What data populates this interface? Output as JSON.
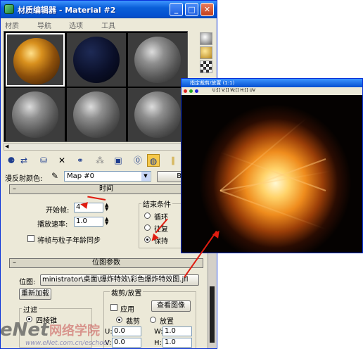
{
  "window": {
    "title": "材质编辑器 - Material #2"
  },
  "menu": [
    "材质",
    "导航",
    "选项",
    "工具"
  ],
  "map_row": {
    "label": "漫反射颜色:",
    "map_name": "Map #0",
    "type": "Bit"
  },
  "time": {
    "header": "时间",
    "start_frame_label": "开始帧:",
    "start_frame": "4",
    "speed_label": "播放速率:",
    "speed": "1.0",
    "sync_label": "将帧与粒子年龄同步"
  },
  "end_condition": {
    "header": "结束条件",
    "options": [
      "循环",
      "往复",
      "保持"
    ],
    "selected": "保持"
  },
  "bitmap": {
    "header": "位图参数",
    "label": "位图:",
    "path": "ministrator\\桌面\\爆炸特效\\彩色爆炸特效图.jfl",
    "reload": "重新加载"
  },
  "crop": {
    "header": "裁剪/放置",
    "apply": "应用",
    "view": "查看图像",
    "crop_label": "裁剪",
    "place_label": "放置",
    "u_label": "U:",
    "u": "0.0",
    "v_label": "V:",
    "v": "0.0",
    "w_label": "W:",
    "w": "1.0",
    "h_label": "H:",
    "h": "1.0"
  },
  "filter": {
    "header": "过滤",
    "option": "四棱锥"
  },
  "preview": {
    "title": "指定裁剪/放置 (1:1)",
    "toolbar": "U:[] V:[] W:[] H:[] UV"
  },
  "watermark": {
    "brand": "eNet",
    "cn": "网络学院",
    "url": "www.eNet.com.cn/eschool"
  },
  "colors": {
    "title_blue": "#0a5fd8",
    "arrow_red": "#e01c10",
    "panel": "#ece9d8"
  }
}
